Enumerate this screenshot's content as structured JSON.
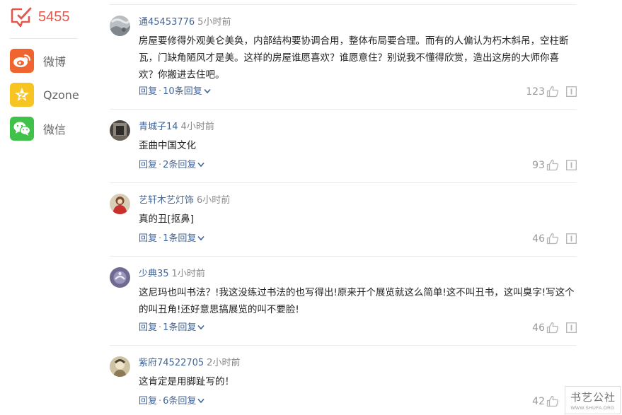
{
  "share": {
    "comment_count": "5455",
    "items": [
      {
        "label": "微博",
        "icon": "weibo-icon"
      },
      {
        "label": "Qzone",
        "icon": "qzone-icon"
      },
      {
        "label": "微信",
        "icon": "wechat-icon"
      }
    ]
  },
  "comments": [
    {
      "user": "通45453776",
      "time": "5小时前",
      "text": "房屋要修得外观美仑美奂，内部结构要协调合用，整体布局要合理。而有的人偏认为朽木斜吊，空柱断瓦，门缺角陋风才是美。这样的房屋谁愿喜欢？谁愿意住？别说我不懂得欣赏，造出这房的大师你喜欢？你搬进去住吧。",
      "reply": "回复",
      "reply_count": "10条回复",
      "likes": "123"
    },
    {
      "user": "青城子14",
      "time": "4小时前",
      "text": "歪曲中国文化",
      "reply": "回复",
      "reply_count": "2条回复",
      "likes": "93"
    },
    {
      "user": "艺轩木艺灯饰",
      "time": "6小时前",
      "text": "真的丑[抠鼻]",
      "reply": "回复",
      "reply_count": "1条回复",
      "likes": "46"
    },
    {
      "user": "少典35",
      "time": "1小时前",
      "text": "这尼玛也叫书法？!我这没练过书法的也写得出!原来开个展览就这么简单!这不叫丑书，这叫臭字!写这个的叫丑角!还好意思搞展览的叫不要脸!",
      "reply": "回复",
      "reply_count": "1条回复",
      "likes": "46"
    },
    {
      "user": "紫府74522705",
      "time": "2小时前",
      "text": "这肯定是用脚趾写的！",
      "reply": "回复",
      "reply_count": "6条回复",
      "likes": "42"
    }
  ],
  "watermark": {
    "seal": "书艺公社",
    "url": "WWW.SHUFA.ORG"
  },
  "colors": {
    "accent_red": "#e5574d",
    "link_blue": "#406599",
    "weibo": "#f0642f",
    "qzone": "#f7c422",
    "wechat": "#3fc14a"
  }
}
